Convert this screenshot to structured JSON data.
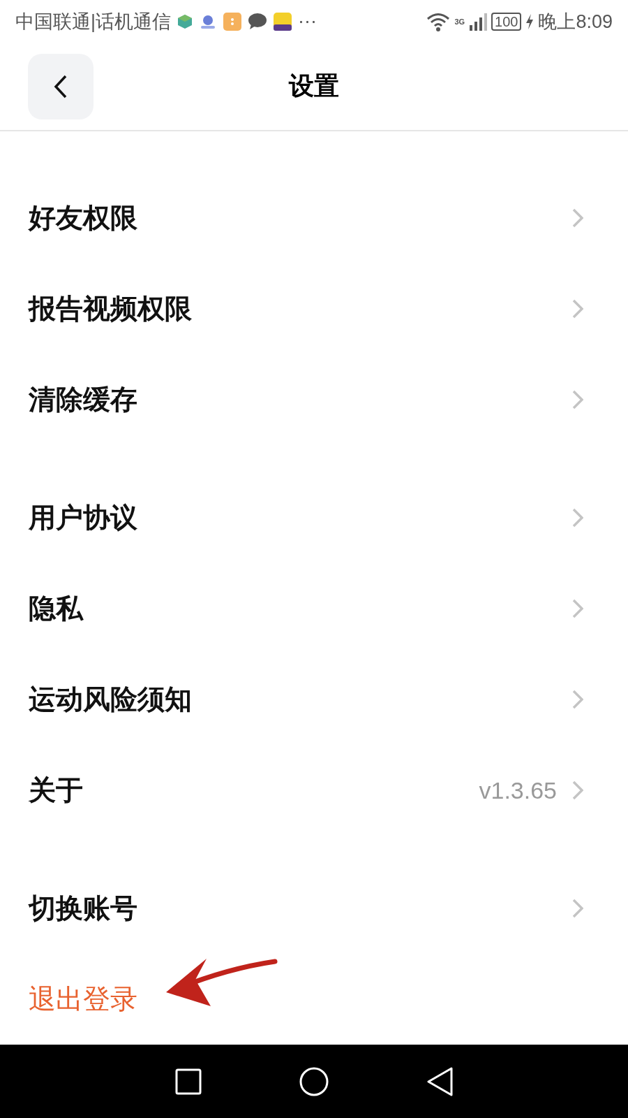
{
  "status_bar": {
    "carrier": "中国联通|话机通信",
    "more": "···",
    "network": "3G",
    "battery": "100",
    "time": "晚上8:09"
  },
  "header": {
    "title": "设置"
  },
  "groups": [
    {
      "rows": [
        {
          "kind": "nav",
          "label": "好友权限"
        },
        {
          "kind": "nav",
          "label": "报告视频权限"
        },
        {
          "kind": "nav",
          "label": "清除缓存"
        }
      ]
    },
    {
      "rows": [
        {
          "kind": "nav",
          "label": "用户协议"
        },
        {
          "kind": "nav",
          "label": "隐私"
        },
        {
          "kind": "nav",
          "label": "运动风险须知"
        },
        {
          "kind": "nav",
          "label": "关于",
          "value": "v1.3.65"
        }
      ]
    },
    {
      "rows": [
        {
          "kind": "nav",
          "label": "切换账号"
        },
        {
          "kind": "danger",
          "label": "退出登录"
        }
      ]
    }
  ]
}
